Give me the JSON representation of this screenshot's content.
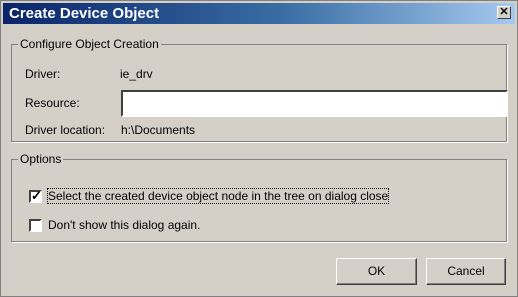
{
  "window": {
    "title": "Create Device Object",
    "close_symbol": "✕"
  },
  "configure_group": {
    "legend": "Configure Object Creation",
    "driver_label": "Driver:",
    "driver_value": "ie_drv",
    "resource_label": "Resource:",
    "resource_value": "",
    "driver_location_label": "Driver location:",
    "driver_location_value": "h:\\Documents"
  },
  "options_group": {
    "legend": "Options",
    "select_node_label": "Select the created device object node in the tree on dialog close",
    "select_node_checked": true,
    "dont_show_label": "Don't show this dialog again.",
    "dont_show_checked": false
  },
  "buttons": {
    "ok_label": "OK",
    "cancel_label": "Cancel"
  },
  "icons": {
    "checkmark": "✓"
  }
}
